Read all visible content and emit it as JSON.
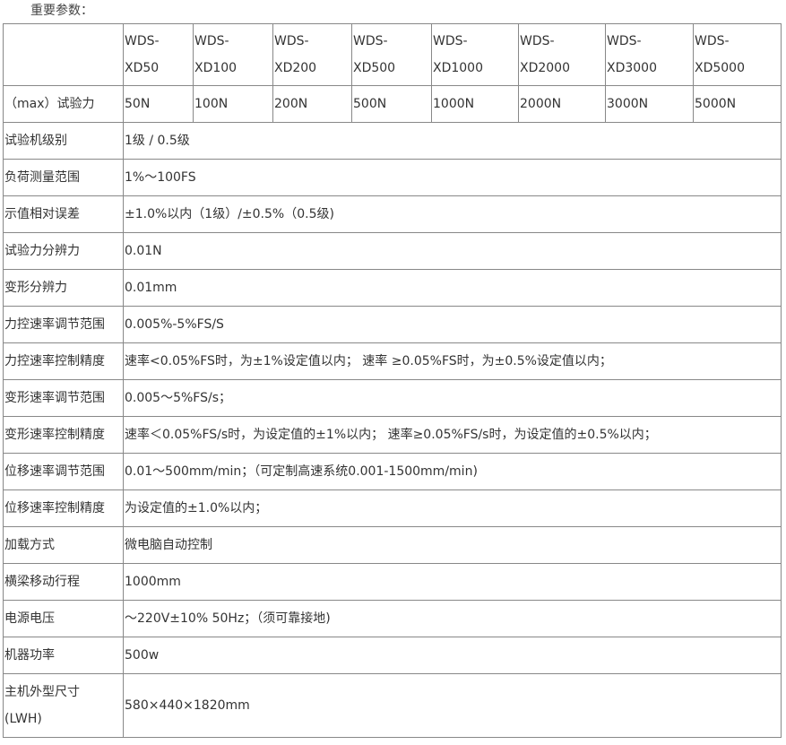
{
  "heading": "重要参数：",
  "models": [
    [
      "WDS-",
      "XD50"
    ],
    [
      "WDS-",
      "XD100"
    ],
    [
      "WDS-",
      "XD200"
    ],
    [
      "WDS-",
      "XD500"
    ],
    [
      "WDS-",
      "XD1000"
    ],
    [
      "WDS-",
      "XD2000"
    ],
    [
      "WDS-",
      "XD3000"
    ],
    [
      "WDS-",
      "XD5000"
    ]
  ],
  "force_row": {
    "label": "（max）试验力",
    "values": [
      "50N",
      "100N",
      "200N",
      "500N",
      "1000N",
      "2000N",
      "3000N",
      "5000N"
    ]
  },
  "rows": [
    {
      "label": "试验机级别",
      "value": "1级 / 0.5级"
    },
    {
      "label": "负荷测量范围",
      "value": "1%～100FS"
    },
    {
      "label": "示值相对误差",
      "value": "±1.0%以内（1级）/±0.5%（0.5级)"
    },
    {
      "label": "试验力分辨力",
      "value": "0.01N"
    },
    {
      "label": "变形分辨力",
      "value": "0.01mm"
    },
    {
      "label": "力控速率调节范围",
      "value": "0.005%-5%FS/S"
    },
    {
      "label": "力控速率控制精度",
      "value": "速率<0.05%FS时，为±1%设定值以内； 速率 ≥0.05%FS时，为±0.5%设定值以内；"
    },
    {
      "label": "变形速率调节范围",
      "value": "0.005～5%FS/s；"
    },
    {
      "label": "变形速率控制精度",
      "value": "速率＜0.05%FS/s时，为设定值的±1%以内； 速率≥0.05%FS/s时，为设定值的±0.5%以内；"
    },
    {
      "label": "位移速率调节范围",
      "value": "0.01～500mm/min；（可定制高速系统0.001-1500mm/min)"
    },
    {
      "label": "位移速率控制精度",
      "value": "为设定值的±1.0%以内；"
    },
    {
      "label": "加载方式",
      "value": "微电脑自动控制"
    },
    {
      "label": "横梁移动行程",
      "value": "1000mm"
    },
    {
      "label": "电源电压",
      "value": "～220V±10% 50Hz；（须可靠接地)"
    },
    {
      "label": "机器功率",
      "value": "500w"
    }
  ],
  "dims_row": {
    "label": [
      "主机外型尺寸",
      "(LWH)"
    ],
    "value": "580×440×1820mm"
  }
}
